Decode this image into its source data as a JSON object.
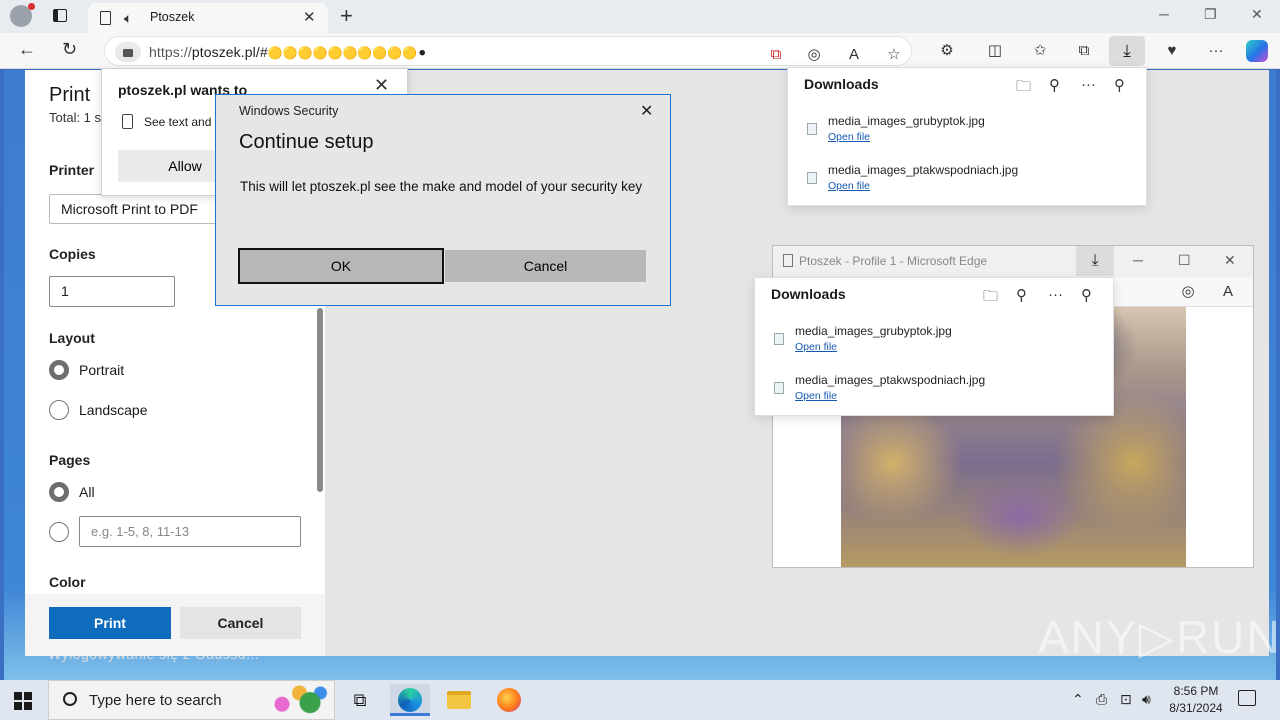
{
  "browser": {
    "tab_title": "Ptoszek",
    "url_proto": "https://",
    "url_rest": "ptoszek.pl/#",
    "url_emoji": "🟡🟡🟡🟡🟡🟡🟡🟡🟡🟡⚫"
  },
  "print": {
    "title": "Print",
    "total": "Total: 1 s",
    "printer_label": "Printer",
    "printer_value": "Microsoft Print to PDF",
    "copies_label": "Copies",
    "copies_value": "1",
    "layout_label": "Layout",
    "portrait": "Portrait",
    "landscape": "Landscape",
    "pages_label": "Pages",
    "pages_all": "All",
    "pages_placeholder": "e.g. 1-5, 8, 11-13",
    "color_label": "Color",
    "print_btn": "Print",
    "cancel_btn": "Cancel",
    "under_text": "Wylogowywanie się z Gaussu..."
  },
  "permission": {
    "title": "ptoszek.pl wants to",
    "item": "See text and i",
    "allow": "Allow"
  },
  "winsec": {
    "caption": "Windows Security",
    "heading": "Continue setup",
    "body": "This will let ptoszek.pl see the make and model of your security key",
    "ok": "OK",
    "cancel": "Cancel"
  },
  "downloads": {
    "title": "Downloads",
    "items": [
      {
        "name": "media_images_grubyptok.jpg",
        "action": "Open file"
      },
      {
        "name": "media_images_ptakwspodniach.jpg",
        "action": "Open file"
      }
    ]
  },
  "window2": {
    "title": "Ptoszek - Profile 1 - Microsoft Edge"
  },
  "taskbar": {
    "search_placeholder": "Type here to search",
    "time": "8:56 PM",
    "date": "8/31/2024"
  },
  "watermark": "ANY▷RUN"
}
